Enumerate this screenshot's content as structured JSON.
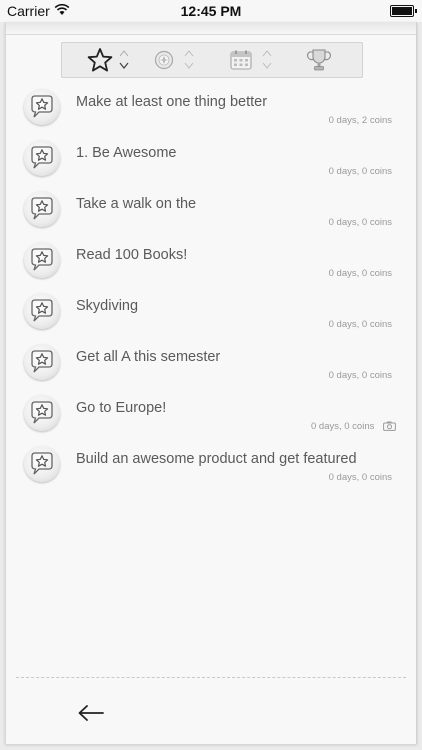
{
  "status_bar": {
    "carrier": "Carrier",
    "time": "12:45 PM",
    "wifi_icon": "wifi-icon",
    "battery_icon": "battery-icon"
  },
  "sort_bar": {
    "items": [
      {
        "name": "star",
        "icon": "star-icon",
        "active": true
      },
      {
        "name": "compass",
        "icon": "compass-icon",
        "active": false
      },
      {
        "name": "calendar",
        "icon": "calendar-icon",
        "active": false
      },
      {
        "name": "trophy",
        "icon": "trophy-icon",
        "active": false
      }
    ]
  },
  "goals": [
    {
      "title": "Make at least one thing better",
      "meta": "0 days, 2 coins",
      "has_photo": false
    },
    {
      "title": "1. Be Awesome",
      "meta": "0 days, 0 coins",
      "has_photo": false
    },
    {
      "title": "Take a walk on the",
      "meta": "0 days, 0 coins",
      "has_photo": false
    },
    {
      "title": "Read 100 Books!",
      "meta": "0 days, 0 coins",
      "has_photo": false
    },
    {
      "title": "Skydiving",
      "meta": "0 days, 0 coins",
      "has_photo": false
    },
    {
      "title": "Get all A this semester",
      "meta": "0 days, 0 coins",
      "has_photo": false
    },
    {
      "title": "Go to Europe!",
      "meta": "0 days, 0 coins",
      "has_photo": true
    },
    {
      "title": "Build an awesome product and get featured",
      "meta": "0 days, 0 coins",
      "has_photo": false
    }
  ],
  "footer": {
    "back_icon": "arrow-left-icon"
  },
  "colors": {
    "paper": "#f8f8f8",
    "text": "#5a5a5a",
    "meta": "#9a9a9a"
  }
}
